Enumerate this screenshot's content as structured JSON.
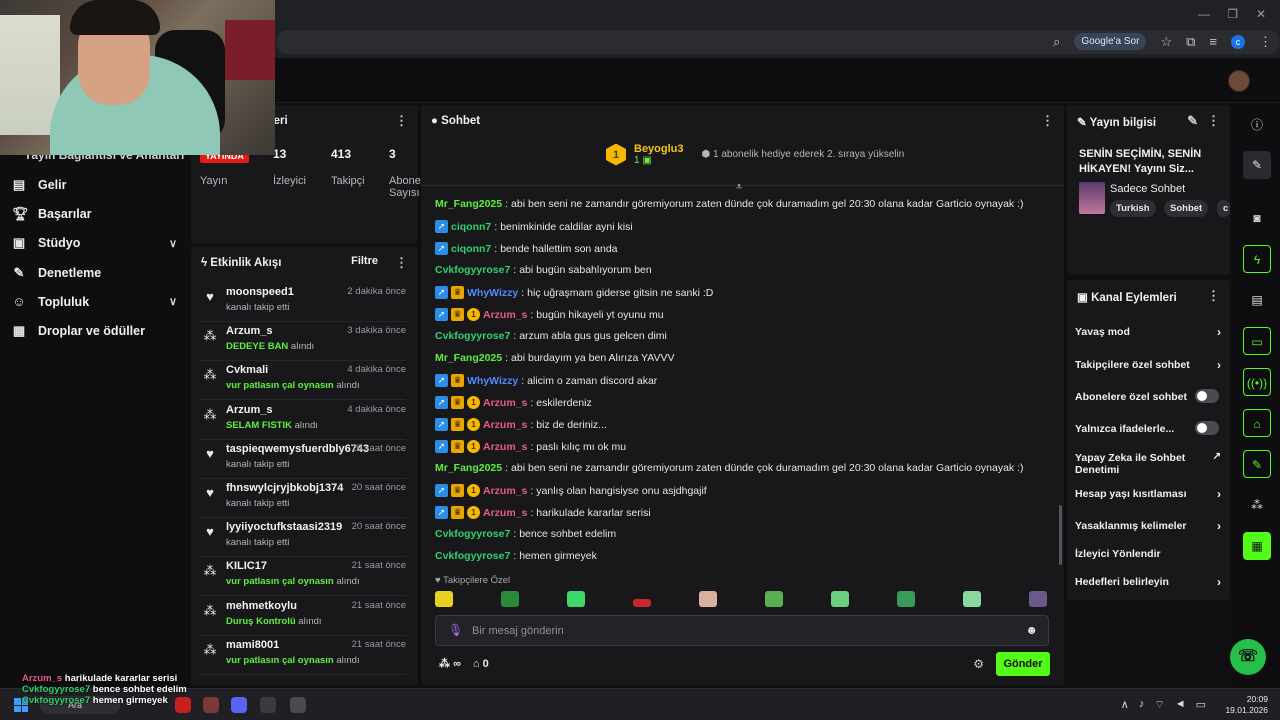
{
  "browser": {
    "google_ask": "Google'a Sor",
    "profile_initial": "c"
  },
  "nav": {
    "partial_label": "Yayın Bağlantısı ve Anahtarı",
    "items": [
      {
        "label": "Gelir",
        "icon": "wallet-icon"
      },
      {
        "label": "Başarılar",
        "icon": "trophy-icon"
      },
      {
        "label": "Stüdyo",
        "icon": "studio-icon",
        "expandable": true
      },
      {
        "label": "Denetleme",
        "icon": "wrench-icon"
      },
      {
        "label": "Topluluk",
        "icon": "people-icon",
        "expandable": true
      },
      {
        "label": "Droplar ve ödüller",
        "icon": "gift-icon"
      }
    ]
  },
  "stats": {
    "title_partial": "tikleri",
    "live_badge": "YAYINDA",
    "broadcast_label": "Yayın",
    "viewers_value": "13",
    "viewers_label": "İzleyici",
    "followers_value": "413",
    "followers_label": "Takipçi",
    "subs_value": "3",
    "subs_label_line1": "Abone",
    "subs_label_line2": "Sayısı"
  },
  "activity": {
    "title": "Etkinlik Akışı",
    "filter_label": "Filtre",
    "items": [
      {
        "icon": "heart-icon",
        "name": "moonspeed1",
        "time": "2 dakika önce",
        "highlight": "",
        "suffix": "kanalı takip etti"
      },
      {
        "icon": "reward-icon",
        "name": "Arzum_s",
        "time": "3 dakika önce",
        "highlight": "DEDEYE BAN",
        "suffix": " alındı"
      },
      {
        "icon": "reward-icon",
        "name": "Cvkmali",
        "time": "4 dakika önce",
        "highlight": "vur patlasın çal oynasın",
        "suffix": " alındı"
      },
      {
        "icon": "reward-icon",
        "name": "Arzum_s",
        "time": "4 dakika önce",
        "highlight": "SELAM FISTIK",
        "suffix": " alındı"
      },
      {
        "icon": "heart-icon",
        "name": "taspieqwemysfuerdbly6743",
        "time": "20 saat önce",
        "highlight": "",
        "suffix": "kanalı takip etti"
      },
      {
        "icon": "heart-icon",
        "name": "fhnswylcjryjbkobj1374",
        "time": "20 saat önce",
        "highlight": "",
        "suffix": "kanalı takip etti"
      },
      {
        "icon": "heart-icon",
        "name": "lyyiiyoctufkstaasi2319",
        "time": "20 saat önce",
        "highlight": "",
        "suffix": "kanalı takip etti"
      },
      {
        "icon": "reward-icon",
        "name": "KILIC17",
        "time": "21 saat önce",
        "highlight": "vur patlasın çal oynasın",
        "suffix": " alındı"
      },
      {
        "icon": "reward-icon",
        "name": "mehmetkoylu",
        "time": "21 saat önce",
        "highlight": "Duruş Kontrolü",
        "suffix": " alındı"
      },
      {
        "icon": "reward-icon",
        "name": "mami8001",
        "time": "21 saat önce",
        "highlight": "vur patlasın çal oynasın",
        "suffix": " alındı"
      }
    ]
  },
  "chat": {
    "title": "Sohbet",
    "pinned": {
      "rank": "1",
      "name": "Beyoglu3",
      "count": "1",
      "text": "1 abonelik hediye ederek 2. sıraya yükselin"
    },
    "messages": [
      {
        "user": "Mr_Fang2025",
        "color": "#5cf03a",
        "badges": [],
        "text": "abi ben seni ne zamandır göremiyorum zaten dünde çok duramadım gel 20:30 olana kadar Garticio oynayak :)"
      },
      {
        "user": "ciqonn7",
        "color": "#2fd16e",
        "badges": [
          "s"
        ],
        "text": "benimkinide caldilar ayni kisi"
      },
      {
        "user": "ciqonn7",
        "color": "#2fd16e",
        "badges": [
          "s"
        ],
        "text": "bende hallettim son anda"
      },
      {
        "user": "Cvkfogyyrose7",
        "color": "#2fd16e",
        "badges": [],
        "text": "abi bugün sabahlıyorum ben"
      },
      {
        "user": "WhyWizzy",
        "color": "#4f8cff",
        "badges": [
          "s",
          "c"
        ],
        "text": "hiç uğraşmam giderse gitsin ne sanki :D"
      },
      {
        "user": "Arzum_s",
        "color": "#e85a8a",
        "badges": [
          "s",
          "c",
          "1"
        ],
        "text": "bugün hikayeli yt oyunu mu"
      },
      {
        "user": "Cvkfogyyrose7",
        "color": "#2fd16e",
        "badges": [],
        "text": "arzum abla gus gus gelcen dimi"
      },
      {
        "user": "Mr_Fang2025",
        "color": "#5cf03a",
        "badges": [],
        "text": "abi burdayım ya ben Alırıza YAVVV"
      },
      {
        "user": "WhyWizzy",
        "color": "#4f8cff",
        "badges": [
          "s",
          "c"
        ],
        "text": "alicim o zaman discord akar"
      },
      {
        "user": "Arzum_s",
        "color": "#e85a8a",
        "badges": [
          "s",
          "c",
          "1"
        ],
        "text": "eskilerdeniz"
      },
      {
        "user": "Arzum_s",
        "color": "#e85a8a",
        "badges": [
          "s",
          "c",
          "1"
        ],
        "text": "biz de deriniz..."
      },
      {
        "user": "Arzum_s",
        "color": "#e85a8a",
        "badges": [
          "s",
          "c",
          "1"
        ],
        "text": "paslı kılıç mı ok mu"
      },
      {
        "user": "Mr_Fang2025",
        "color": "#5cf03a",
        "badges": [],
        "text": "abi ben seni ne zamandır göremiyorum zaten dünde çok duramadım gel 20:30 olana kadar Garticio oynayak :)"
      },
      {
        "user": "Arzum_s",
        "color": "#e85a8a",
        "badges": [
          "s",
          "c",
          "1"
        ],
        "text": "yanlış olan hangisiyse onu asjdhgajif"
      },
      {
        "user": "Arzum_s",
        "color": "#e85a8a",
        "badges": [
          "s",
          "c",
          "1"
        ],
        "text": "harikulade kararlar serisi"
      },
      {
        "user": "Cvkfogyyrose7",
        "color": "#2fd16e",
        "badges": [],
        "text": "bence sohbet edelim"
      },
      {
        "user": "Cvkfogyyrose7",
        "color": "#2fd16e",
        "badges": [],
        "text": "hemen girmeyek"
      }
    ],
    "followers_only": "Takipçilere Özel",
    "input_placeholder": "Bir mesaj gönderin",
    "points_label": "∞",
    "store_count": "0",
    "send_label": "Gönder"
  },
  "stream_info": {
    "title": "Yayın bilgisi",
    "stream_title": "SENİN SEÇİMİN, SENİN HİKAYEN! Yayını Siz...",
    "category": "Sadece Sohbet",
    "tags": [
      "Turkish",
      "Sohbet",
      "c"
    ]
  },
  "channel_actions": {
    "title": "Kanal Eylemleri",
    "items": [
      {
        "label": "Yavaş mod",
        "control": "arrow"
      },
      {
        "label": "Takipçilere özel sohbet",
        "control": "arrow"
      },
      {
        "label": "Abonelere özel sohbet",
        "control": "toggle"
      },
      {
        "label": "Yalnızca ifadelerle...",
        "control": "toggle"
      },
      {
        "label": "Yapay Zeka ile Sohbet Denetimi",
        "control": "external"
      },
      {
        "label": "Hesap yaşı kısıtlaması",
        "control": "arrow"
      },
      {
        "label": "Yasaklanmış kelimeler",
        "control": "arrow"
      },
      {
        "label": "İzleyici Yönlendir",
        "control": "none"
      },
      {
        "label": "Hedefleri belirleyin",
        "control": "arrow"
      }
    ]
  },
  "overlay_chat": [
    {
      "user": "Arzum_s",
      "text": "harikulade kararlar serisi"
    },
    {
      "user": "Cvkfogyyrose7",
      "text": "bence sohbet edelim"
    },
    {
      "user": "Cvkfogyyrose7",
      "text": "hemen girmeyek"
    }
  ],
  "taskbar": {
    "search_label": "Ara",
    "time": "20:09",
    "date": "19.01.2026"
  },
  "colors": {
    "accent": "#53fc18",
    "live": "#e91916",
    "panel": "#18181b",
    "background": "#0e0e10"
  }
}
